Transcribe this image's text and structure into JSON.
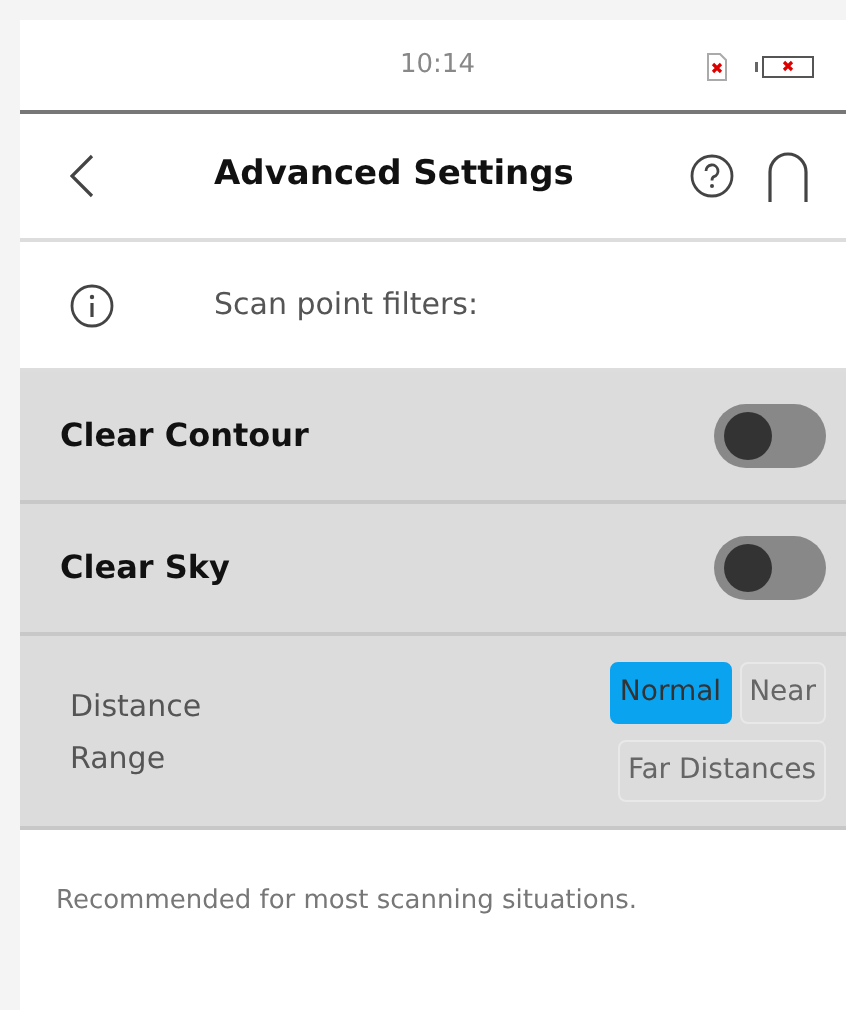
{
  "status_bar": {
    "time": "10:14"
  },
  "header": {
    "title": "Advanced Settings"
  },
  "info": {
    "text": "Scan point filters:"
  },
  "filters": [
    {
      "label": "Clear Contour",
      "on": false
    },
    {
      "label": "Clear Sky",
      "on": false
    }
  ],
  "distance_range": {
    "label": "Distance Range",
    "options": [
      {
        "label": "Normal",
        "selected": true
      },
      {
        "label": "Near",
        "selected": false
      },
      {
        "label": "Far Distances",
        "selected": false
      }
    ]
  },
  "description": "Recommended for most scanning situations."
}
